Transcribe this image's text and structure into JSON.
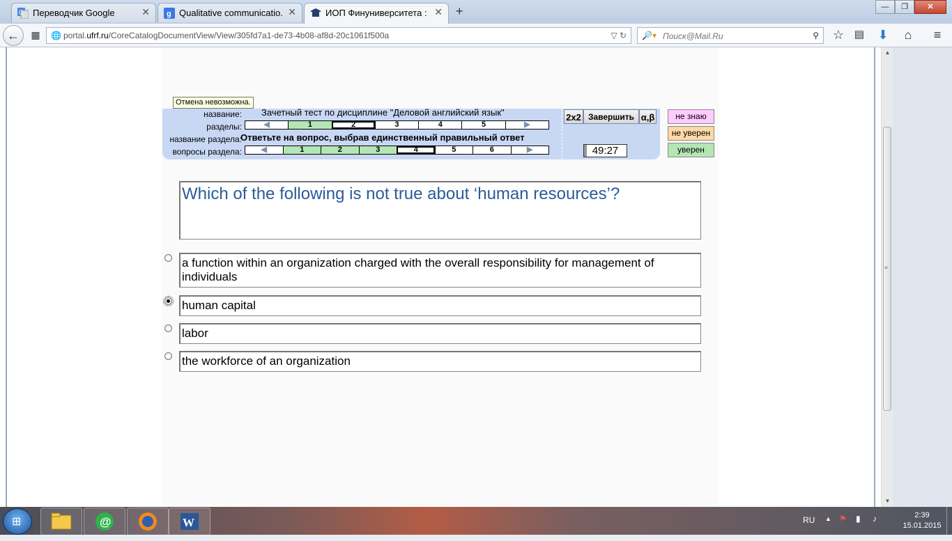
{
  "browser": {
    "tabs": [
      {
        "label": "Переводчик Google",
        "icon": "google-translate-icon"
      },
      {
        "label": "Qualitative communicatio...",
        "icon": "google-icon"
      },
      {
        "label": "ИОП Финуниверситета : ...",
        "icon": "university-icon"
      }
    ],
    "new_tab": "+",
    "url_prefix": "portal.",
    "url_domain": "ufrf.ru",
    "url_path": "/CoreCatalogDocumentView/View/305fd7a1-de73-4b08-af8d-20c1061f500a",
    "search_placeholder": "Поиск@Mail.Ru",
    "window_controls": {
      "minimize": "—",
      "maximize": "❐",
      "close": "✕"
    }
  },
  "test": {
    "tooltip": "Отмена невозможна.",
    "labels": {
      "name": "название:",
      "sections": "разделы:",
      "section_name": "название раздела:",
      "section_questions": "вопросы раздела:"
    },
    "title": "Зачетный тест по дисциплине \"Деловой английский язык\"",
    "section_title": "Ответьте на вопрос, выбрав единственный правильный ответ",
    "sections": [
      "1",
      "2",
      "3",
      "4",
      "5"
    ],
    "questions": [
      "1",
      "2",
      "3",
      "4",
      "5",
      "6"
    ],
    "buttons": {
      "calc": "2x2",
      "finish": "Завершить",
      "symbols": "α,β"
    },
    "timer": "49:27",
    "confidence": {
      "dont_know": "не знаю",
      "not_sure": "не уверен",
      "sure": "уверен"
    },
    "colors": {
      "done": "#b4e6b4",
      "header_bg": "#c8d8f4",
      "dont_know": "#ffccff",
      "not_sure": "#ffd9a8",
      "sure": "#b4e6b4",
      "question_text": "#2a5b9a"
    }
  },
  "question": {
    "text": "Which of the following is not true about ‘human resources’?",
    "answers": [
      "a function within an organization charged with the overall responsibility for management of individuals",
      "human capital",
      "labor",
      "the workforce of an organization"
    ],
    "selected_index": 1
  },
  "taskbar": {
    "items": [
      "explorer-icon",
      "mail-agent-icon",
      "firefox-icon",
      "word-icon"
    ],
    "language": "RU",
    "time": "2:39",
    "date": "15.01.2015"
  }
}
